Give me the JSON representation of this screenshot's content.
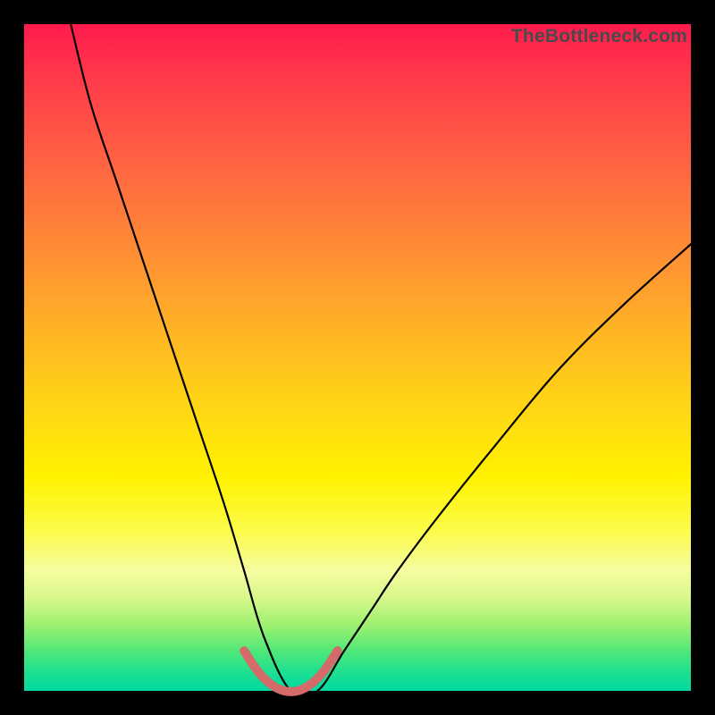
{
  "watermark": "TheBottleneck.com",
  "chart_data": {
    "type": "line",
    "title": "",
    "xlabel": "",
    "ylabel": "",
    "xlim": [
      0,
      100
    ],
    "ylim": [
      0,
      100
    ],
    "grid": false,
    "description": "V-shaped bottleneck curve over a red-to-green vertical gradient background. The curve value (height above the bottom) is the bottleneck percentage; the minimum near x≈40 indicates the optimal match.",
    "series": [
      {
        "name": "bottleneck-curve",
        "color": "#000000",
        "x": [
          7,
          10,
          14,
          18,
          22,
          26,
          30,
          33,
          36,
          40,
          44,
          48,
          52,
          56,
          62,
          70,
          80,
          90,
          100
        ],
        "values": [
          100,
          88,
          76,
          64,
          52,
          40,
          28,
          18,
          8,
          0,
          0,
          6,
          12,
          18,
          26,
          36,
          48,
          58,
          67
        ]
      },
      {
        "name": "optimal-segment",
        "color": "#d46a6a",
        "x": [
          33,
          35,
          37,
          39,
          41,
          43,
          45,
          47
        ],
        "values": [
          6,
          3,
          1,
          0,
          0,
          1,
          3,
          6
        ]
      }
    ]
  }
}
